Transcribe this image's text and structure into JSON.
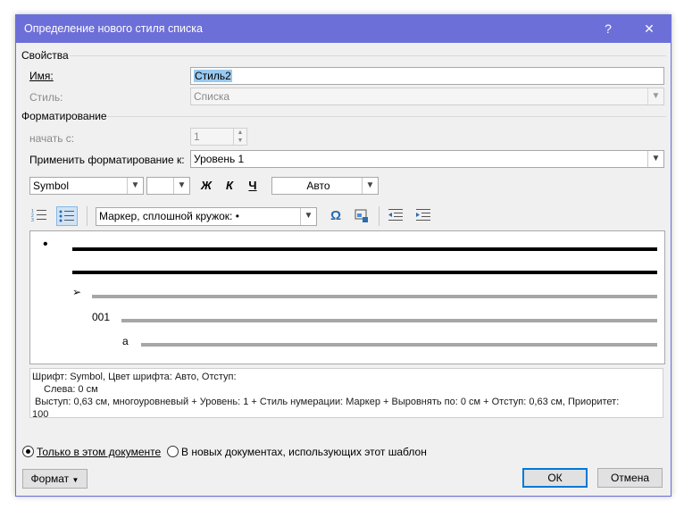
{
  "window": {
    "title": "Определение нового стиля списка",
    "help_symbol": "?",
    "close_symbol": "✕"
  },
  "properties": {
    "section": "Свойства",
    "name_label": "Имя:",
    "name_value": "Стиль2",
    "style_label": "Стиль:",
    "style_value": "Списка"
  },
  "formatting": {
    "section": "Форматирование",
    "start_label": "начать с:",
    "start_value": "1",
    "apply_label": "Применить форматирование к:",
    "apply_value": "Уровень 1",
    "font_value": "Symbol",
    "size_value": "",
    "bold": "Ж",
    "italic": "К",
    "underline": "Ч",
    "color_value": "Авто",
    "bullet_value": "Маркер, сплошной кружок: •",
    "symbol_glyph": "Ω"
  },
  "preview": {
    "level1_marker": "•",
    "level2_marker": "➢",
    "level3_marker": "001",
    "level4_marker": "a"
  },
  "description": {
    "line1": "Шрифт: Symbol, Цвет шрифта: Авто, Отступ:",
    "line2": "Слева:  0 см",
    "line3": "Выступ:  0,63 см, многоуровневый + Уровень: 1 + Стиль нумерации: Маркер + Выровнять по:  0 см + Отступ:  0,63 см, Приоритет:",
    "line4": "100"
  },
  "scope": {
    "only_this_doc": "Только в этом документе",
    "new_docs": "В новых документах, использующих этот шаблон"
  },
  "buttons": {
    "format": "Формат",
    "ok": "ОК",
    "cancel": "Отмена"
  },
  "colors": {
    "titlebar": "#6d6fd9",
    "selection": "#99c9ef"
  }
}
